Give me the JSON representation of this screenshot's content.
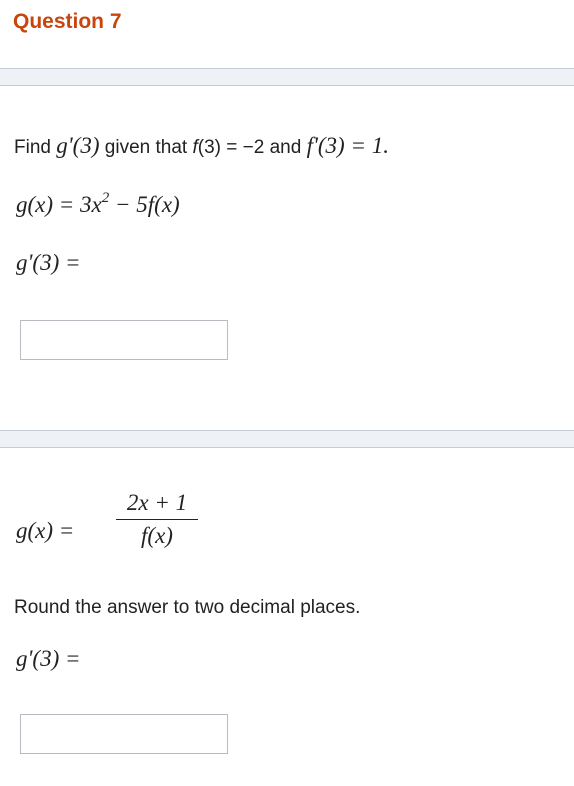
{
  "question": {
    "title": "Question 7"
  },
  "part1": {
    "prompt_prefix": "Find",
    "prompt_gprime": "g'(3)",
    "prompt_mid": "given that",
    "prompt_f": "f",
    "prompt_f_value": "(3) = −2 and",
    "prompt_fprime": "f'(3) = 1.",
    "equation_lhs": "g(x) = 3x",
    "equation_exp": "2",
    "equation_rhs": " − 5f(x)",
    "answer_label": "g'(3) =",
    "answer_value": ""
  },
  "part2": {
    "function_lhs": "g(x) =",
    "numerator": "2x + 1",
    "denominator": "f(x)",
    "instruction": "Round the answer to two decimal places.",
    "answer_label": "g'(3) =",
    "answer_value": ""
  }
}
